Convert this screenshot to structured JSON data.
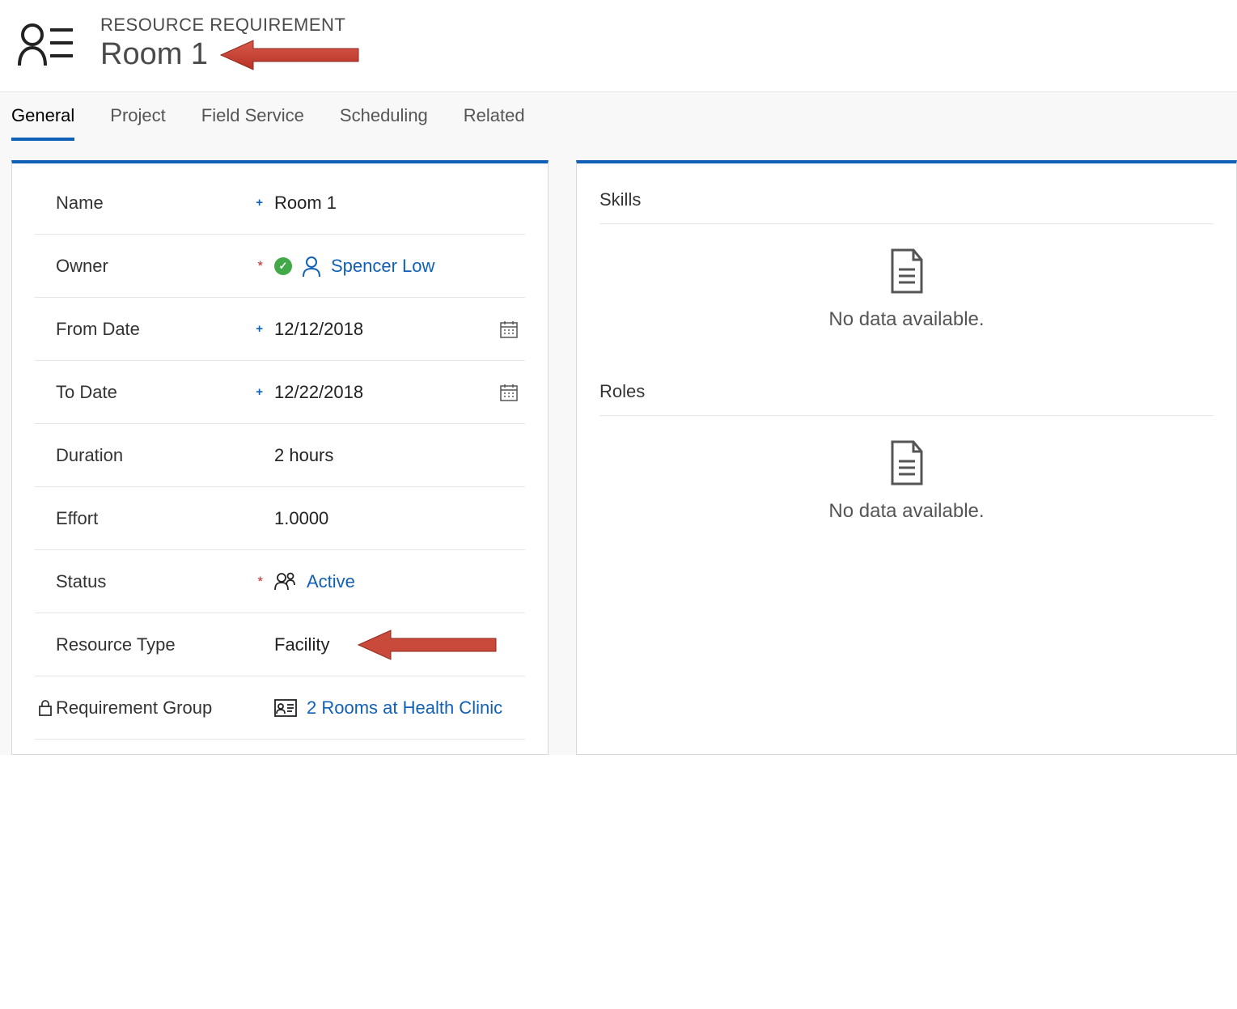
{
  "header": {
    "eyebrow": "RESOURCE REQUIREMENT",
    "title": "Room 1"
  },
  "tabs": [
    {
      "label": "General",
      "active": true
    },
    {
      "label": "Project",
      "active": false
    },
    {
      "label": "Field Service",
      "active": false
    },
    {
      "label": "Scheduling",
      "active": false
    },
    {
      "label": "Related",
      "active": false
    }
  ],
  "fields": {
    "name": {
      "label": "Name",
      "value": "Room 1"
    },
    "owner": {
      "label": "Owner",
      "value": "Spencer Low"
    },
    "fromDate": {
      "label": "From Date",
      "value": "12/12/2018"
    },
    "toDate": {
      "label": "To Date",
      "value": "12/22/2018"
    },
    "duration": {
      "label": "Duration",
      "value": "2 hours"
    },
    "effort": {
      "label": "Effort",
      "value": "1.0000"
    },
    "status": {
      "label": "Status",
      "value": "Active"
    },
    "resourceType": {
      "label": "Resource Type",
      "value": "Facility"
    },
    "requirementGroup": {
      "label": "Requirement Group",
      "value": "2 Rooms at Health Clinic"
    }
  },
  "sidePanel": {
    "skills": {
      "header": "Skills",
      "empty": "No data available."
    },
    "roles": {
      "header": "Roles",
      "empty": "No data available."
    }
  },
  "colors": {
    "accent": "#1160b7",
    "success": "#42a948",
    "required": "#c22a2a",
    "annotation": "#c0392b"
  }
}
